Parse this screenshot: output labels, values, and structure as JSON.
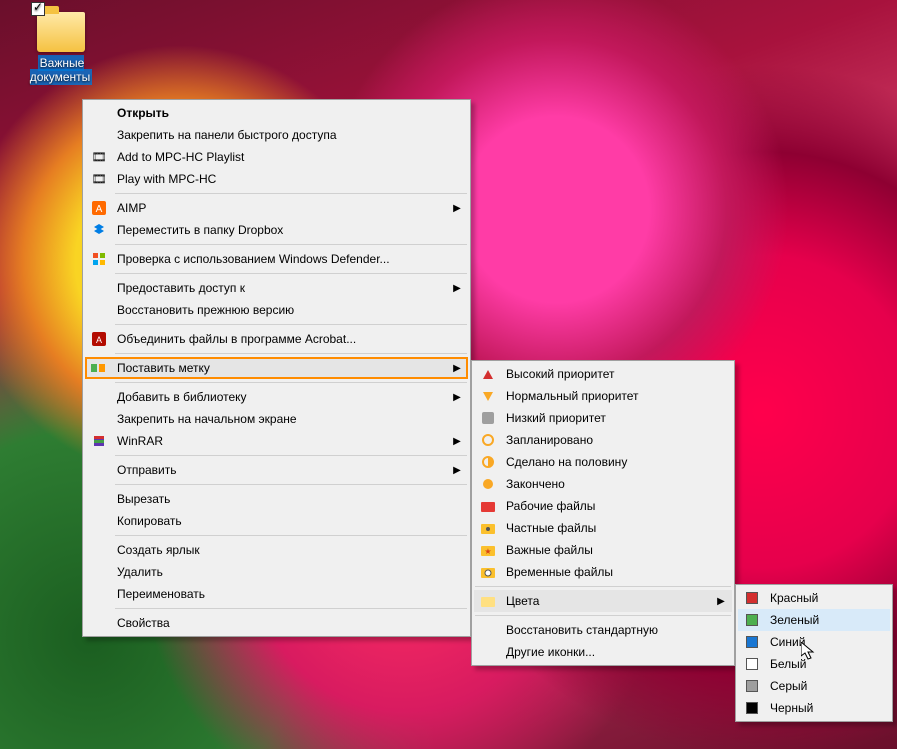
{
  "desktop": {
    "folder_label": "Важные документы"
  },
  "menu": {
    "open": "Открыть",
    "pin_quick": "Закрепить на панели быстрого доступа",
    "add_mpc": "Add to MPC-HC Playlist",
    "play_mpc": "Play with MPC-HC",
    "aimp": "AIMP",
    "dropbox": "Переместить в папку Dropbox",
    "defender": "Проверка с использованием Windows Defender...",
    "share": "Предоставить доступ к",
    "restore_prev": "Восстановить прежнюю версию",
    "acrobat": "Объединить файлы в программе Acrobat...",
    "set_tag": "Поставить метку",
    "add_library": "Добавить в библиотеку",
    "pin_start": "Закрепить на начальном экране",
    "winrar": "WinRAR",
    "send_to": "Отправить",
    "cut": "Вырезать",
    "copy": "Копировать",
    "shortcut": "Создать ярлык",
    "delete": "Удалить",
    "rename": "Переименовать",
    "properties": "Свойства"
  },
  "tags": {
    "high": "Высокий приоритет",
    "normal": "Нормальный приоритет",
    "low": "Низкий приоритет",
    "planned": "Запланировано",
    "half": "Сделано на половину",
    "done": "Закончено",
    "work": "Рабочие файлы",
    "private": "Частные файлы",
    "important": "Важные файлы",
    "temp": "Временные файлы",
    "colors": "Цвета",
    "restore": "Восстановить стандартную",
    "other": "Другие иконки..."
  },
  "colors": {
    "red": {
      "label": "Красный",
      "hex": "#d32f2f"
    },
    "green": {
      "label": "Зеленый",
      "hex": "#4caf50"
    },
    "blue": {
      "label": "Синий",
      "hex": "#1976d2"
    },
    "white": {
      "label": "Белый",
      "hex": "#ffffff"
    },
    "gray": {
      "label": "Серый",
      "hex": "#9e9e9e"
    },
    "black": {
      "label": "Черный",
      "hex": "#000000"
    }
  }
}
